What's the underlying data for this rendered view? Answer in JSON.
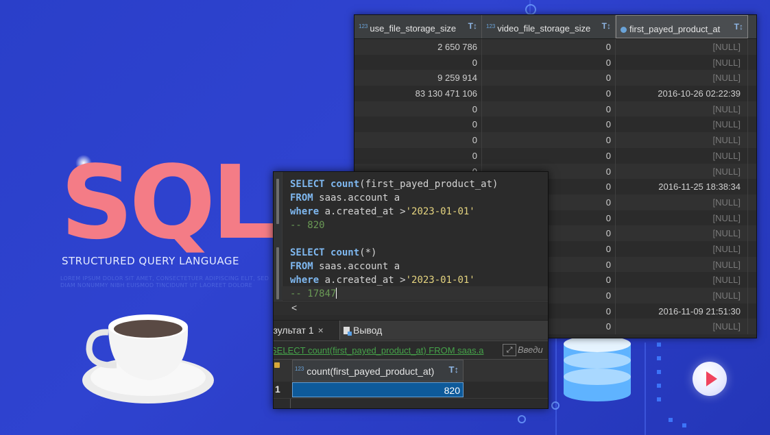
{
  "branding": {
    "logo_text": "SQL",
    "subtitle": "STRUCTURED QUERY LANGUAGE",
    "lorem": "LOREM IPSUM DOLOR SIT AMET, CONSECTETUER ADIPISCING ELIT, SED DIAM NONUMMY NIBH EUISMOD TINCIDUNT UT LAOREET DOLORE"
  },
  "grid": {
    "columns": [
      {
        "label": "use_file_storage_size",
        "type_badge": "123",
        "sort_icon": "sort-icon"
      },
      {
        "label": "video_file_storage_size",
        "type_badge": "123",
        "sort_icon": "sort-icon"
      },
      {
        "label": "first_payed_product_at",
        "type_icon": "clock-icon",
        "sort_icon": "sort-icon"
      }
    ],
    "rows": [
      [
        "2 650 786",
        "0",
        "[NULL]"
      ],
      [
        "0",
        "0",
        "[NULL]"
      ],
      [
        "9 259 914",
        "0",
        "[NULL]"
      ],
      [
        "83 130 471 106",
        "0",
        "2016-10-26 02:22:39"
      ],
      [
        "0",
        "0",
        "[NULL]"
      ],
      [
        "0",
        "0",
        "[NULL]"
      ],
      [
        "0",
        "0",
        "[NULL]"
      ],
      [
        "0",
        "0",
        "[NULL]"
      ],
      [
        "0",
        "0",
        "[NULL]"
      ],
      [
        "",
        "0",
        "2016-11-25 18:38:34"
      ],
      [
        "",
        "0",
        "[NULL]"
      ],
      [
        "",
        "0",
        "[NULL]"
      ],
      [
        "",
        "0",
        "[NULL]"
      ],
      [
        "",
        "0",
        "[NULL]"
      ],
      [
        "",
        "0",
        "[NULL]"
      ],
      [
        "",
        "0",
        "[NULL]"
      ],
      [
        "",
        "0",
        "[NULL]"
      ],
      [
        "",
        "0",
        "2016-11-09 21:51:30"
      ],
      [
        "",
        "0",
        "[NULL]"
      ]
    ]
  },
  "editor": {
    "lines": [
      {
        "parts": [
          [
            "kw",
            "SELECT"
          ],
          [
            "t",
            " "
          ],
          [
            "kw",
            "count"
          ],
          [
            "t",
            "(first_payed_product_at)"
          ]
        ]
      },
      {
        "parts": [
          [
            "kw",
            "FROM"
          ],
          [
            "t",
            " saas.account a"
          ]
        ]
      },
      {
        "parts": [
          [
            "kw",
            "where"
          ],
          [
            "t",
            " a.created_at >"
          ],
          [
            "str",
            "'2023-01-01'"
          ]
        ]
      },
      {
        "parts": [
          [
            "cm",
            "-- 820"
          ]
        ]
      },
      {
        "parts": []
      },
      {
        "parts": [
          [
            "kw",
            "SELECT"
          ],
          [
            "t",
            " "
          ],
          [
            "kw",
            "count"
          ],
          [
            "t",
            "(*)"
          ]
        ]
      },
      {
        "parts": [
          [
            "kw",
            "FROM"
          ],
          [
            "t",
            " saas.account a"
          ]
        ]
      },
      {
        "parts": [
          [
            "kw",
            "where"
          ],
          [
            "t",
            " a.created_at >"
          ],
          [
            "str",
            "'2023-01-01'"
          ]
        ]
      },
      {
        "parts": [
          [
            "cm",
            "-- 17847"
          ]
        ]
      }
    ],
    "scroll_left": "<"
  },
  "tabs": {
    "results": "езультат 1",
    "close": "×",
    "output": "Вывод"
  },
  "filter": {
    "query": "SELECT count(first_payed_product_at) FROM saas.a",
    "expand_icon": "⤢",
    "hint": "Введи"
  },
  "result": {
    "type_badge": "123",
    "column": "count(first_payed_product_at)",
    "row_number": "1",
    "value": "820"
  }
}
